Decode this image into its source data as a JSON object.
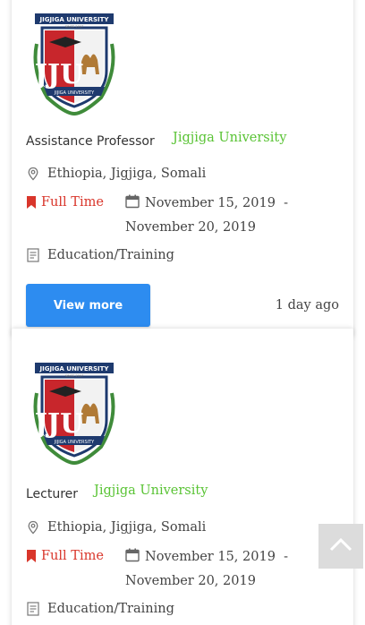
{
  "jobs": [
    {
      "title": "Assistance Professor",
      "company": "Jigjiga University",
      "location": "Ethiopia, Jigjiga, Somali",
      "job_type": "Full Time",
      "date_start": "November 15, 2019",
      "date_end": "November 20, 2019",
      "category": "Education/Training",
      "button_label": "View more",
      "posted": "1 day ago"
    },
    {
      "title": "Lecturer",
      "company": "Jigjiga University",
      "location": "Ethiopia, Jigjiga, Somali",
      "job_type": "Full Time",
      "date_start": "November 15, 2019",
      "date_end": "November 20, 2019",
      "category": "Education/Training"
    }
  ],
  "logo": {
    "top_text": "JIGJIGA UNIVERSITY",
    "since": "SINCE 2007",
    "banner": "JIJIGA UNIVERSITY",
    "letters": "JJU"
  },
  "colors": {
    "accent_green": "#59c334",
    "button_blue": "#2d8cf0",
    "job_type_red": "#d9362b",
    "scroll_top_bg": "#dcdcdc"
  },
  "icons": {
    "location": "map-pin-icon",
    "job_type": "bookmark-icon",
    "date": "calendar-icon",
    "category": "document-icon",
    "scroll_top": "chevron-up-icon"
  }
}
